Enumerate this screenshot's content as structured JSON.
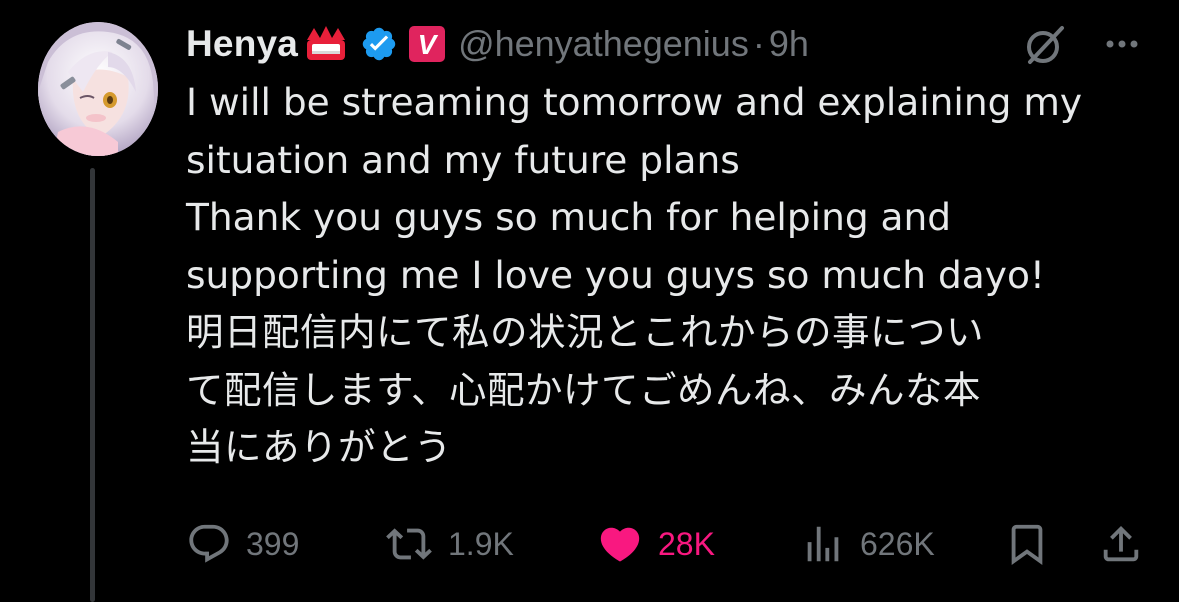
{
  "tweet": {
    "display_name": "Henya",
    "handle": "@henyathegenius",
    "separator": "·",
    "time": "9h",
    "body_lines": [
      "I will be streaming tomorrow and explaining my",
      "situation and my future plans",
      "Thank you guys so much for helping and",
      "supporting me I love you guys so much dayo!",
      "明日配信内にて私の状況とこれからの事につい",
      "て配信します、心配かけてごめんね、みんな本",
      "当にありがとう"
    ],
    "badges": [
      "crown-emoji-badge",
      "verified-badge",
      "affiliate-v-badge"
    ],
    "affiliate_letter": "V"
  },
  "actions": {
    "replies": "399",
    "reposts": "1.9K",
    "likes": "28K",
    "views": "626K",
    "liked": true
  },
  "colors": {
    "background": "#000000",
    "text": "#e7e9ea",
    "muted": "#71767b",
    "like": "#f91880",
    "verified": "#1d9bf0",
    "affiliate": "#e0245e"
  }
}
